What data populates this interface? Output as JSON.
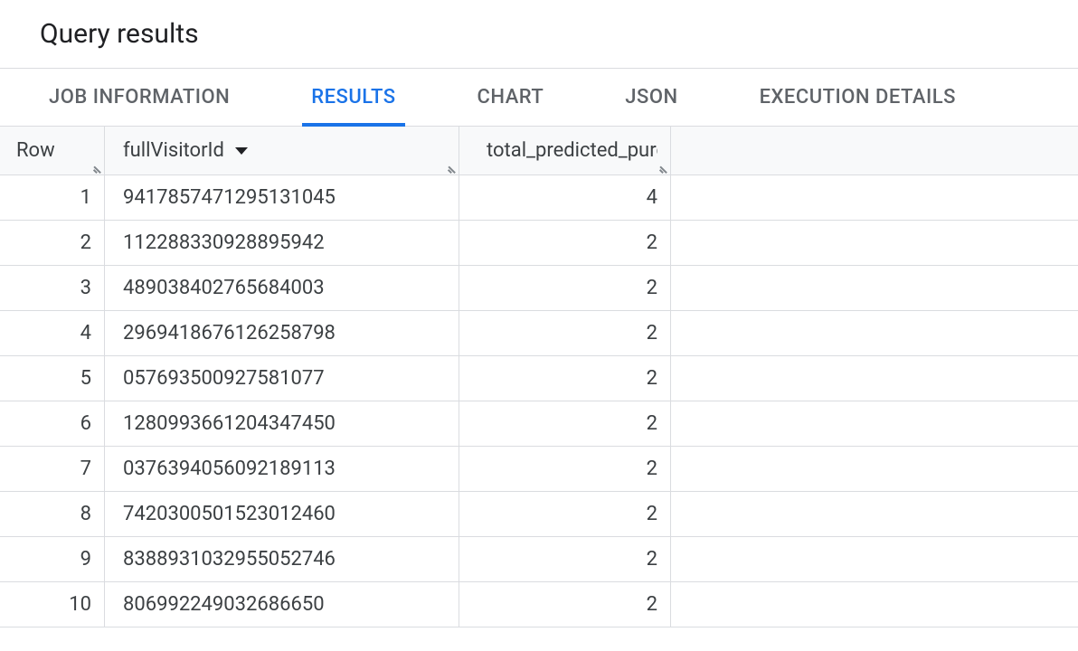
{
  "title": "Query results",
  "tabs": [
    {
      "label": "JOB INFORMATION",
      "active": false
    },
    {
      "label": "RESULTS",
      "active": true
    },
    {
      "label": "CHART",
      "active": false
    },
    {
      "label": "JSON",
      "active": false
    },
    {
      "label": "EXECUTION DETAILS",
      "active": false
    }
  ],
  "columns": {
    "row": "Row",
    "fullVisitorId": "fullVisitorId",
    "total_predicted_purchases": "total_predicted_purchases"
  },
  "rows": [
    {
      "n": "1",
      "visitor": "9417857471295131045",
      "predicted": "4"
    },
    {
      "n": "2",
      "visitor": "112288330928895942",
      "predicted": "2"
    },
    {
      "n": "3",
      "visitor": "489038402765684003",
      "predicted": "2"
    },
    {
      "n": "4",
      "visitor": "2969418676126258798",
      "predicted": "2"
    },
    {
      "n": "5",
      "visitor": "057693500927581077",
      "predicted": "2"
    },
    {
      "n": "6",
      "visitor": "1280993661204347450",
      "predicted": "2"
    },
    {
      "n": "7",
      "visitor": "0376394056092189113",
      "predicted": "2"
    },
    {
      "n": "8",
      "visitor": "7420300501523012460",
      "predicted": "2"
    },
    {
      "n": "9",
      "visitor": "8388931032955052746",
      "predicted": "2"
    },
    {
      "n": "10",
      "visitor": "806992249032686650",
      "predicted": "2"
    }
  ]
}
